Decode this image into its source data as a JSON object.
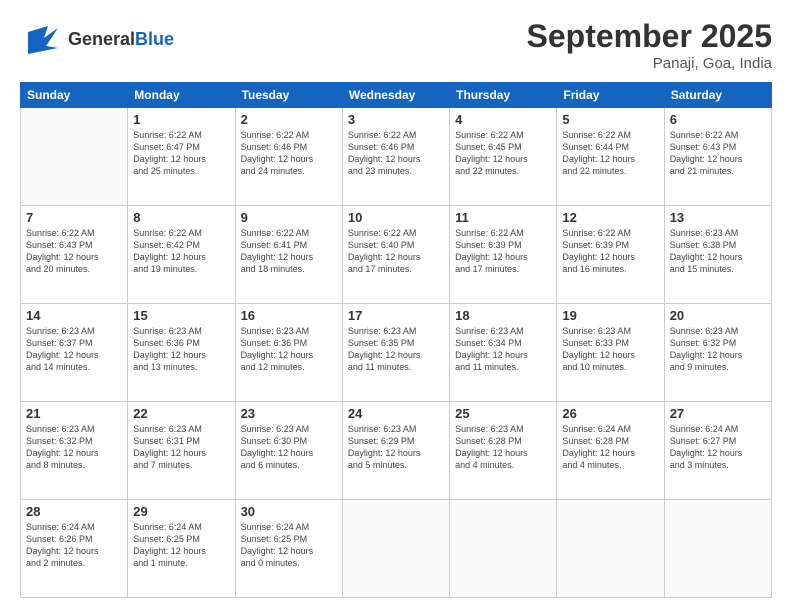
{
  "logo": {
    "general": "General",
    "blue": "Blue"
  },
  "header": {
    "month": "September 2025",
    "location": "Panaji, Goa, India"
  },
  "days_of_week": [
    "Sunday",
    "Monday",
    "Tuesday",
    "Wednesday",
    "Thursday",
    "Friday",
    "Saturday"
  ],
  "weeks": [
    [
      {
        "day": "",
        "info": ""
      },
      {
        "day": "1",
        "info": "Sunrise: 6:22 AM\nSunset: 6:47 PM\nDaylight: 12 hours\nand 25 minutes."
      },
      {
        "day": "2",
        "info": "Sunrise: 6:22 AM\nSunset: 6:46 PM\nDaylight: 12 hours\nand 24 minutes."
      },
      {
        "day": "3",
        "info": "Sunrise: 6:22 AM\nSunset: 6:46 PM\nDaylight: 12 hours\nand 23 minutes."
      },
      {
        "day": "4",
        "info": "Sunrise: 6:22 AM\nSunset: 6:45 PM\nDaylight: 12 hours\nand 22 minutes."
      },
      {
        "day": "5",
        "info": "Sunrise: 6:22 AM\nSunset: 6:44 PM\nDaylight: 12 hours\nand 22 minutes."
      },
      {
        "day": "6",
        "info": "Sunrise: 6:22 AM\nSunset: 6:43 PM\nDaylight: 12 hours\nand 21 minutes."
      }
    ],
    [
      {
        "day": "7",
        "info": "Sunrise: 6:22 AM\nSunset: 6:43 PM\nDaylight: 12 hours\nand 20 minutes."
      },
      {
        "day": "8",
        "info": "Sunrise: 6:22 AM\nSunset: 6:42 PM\nDaylight: 12 hours\nand 19 minutes."
      },
      {
        "day": "9",
        "info": "Sunrise: 6:22 AM\nSunset: 6:41 PM\nDaylight: 12 hours\nand 18 minutes."
      },
      {
        "day": "10",
        "info": "Sunrise: 6:22 AM\nSunset: 6:40 PM\nDaylight: 12 hours\nand 17 minutes."
      },
      {
        "day": "11",
        "info": "Sunrise: 6:22 AM\nSunset: 6:39 PM\nDaylight: 12 hours\nand 17 minutes."
      },
      {
        "day": "12",
        "info": "Sunrise: 6:22 AM\nSunset: 6:39 PM\nDaylight: 12 hours\nand 16 minutes."
      },
      {
        "day": "13",
        "info": "Sunrise: 6:23 AM\nSunset: 6:38 PM\nDaylight: 12 hours\nand 15 minutes."
      }
    ],
    [
      {
        "day": "14",
        "info": "Sunrise: 6:23 AM\nSunset: 6:37 PM\nDaylight: 12 hours\nand 14 minutes."
      },
      {
        "day": "15",
        "info": "Sunrise: 6:23 AM\nSunset: 6:36 PM\nDaylight: 12 hours\nand 13 minutes."
      },
      {
        "day": "16",
        "info": "Sunrise: 6:23 AM\nSunset: 6:36 PM\nDaylight: 12 hours\nand 12 minutes."
      },
      {
        "day": "17",
        "info": "Sunrise: 6:23 AM\nSunset: 6:35 PM\nDaylight: 12 hours\nand 11 minutes."
      },
      {
        "day": "18",
        "info": "Sunrise: 6:23 AM\nSunset: 6:34 PM\nDaylight: 12 hours\nand 11 minutes."
      },
      {
        "day": "19",
        "info": "Sunrise: 6:23 AM\nSunset: 6:33 PM\nDaylight: 12 hours\nand 10 minutes."
      },
      {
        "day": "20",
        "info": "Sunrise: 6:23 AM\nSunset: 6:32 PM\nDaylight: 12 hours\nand 9 minutes."
      }
    ],
    [
      {
        "day": "21",
        "info": "Sunrise: 6:23 AM\nSunset: 6:32 PM\nDaylight: 12 hours\nand 8 minutes."
      },
      {
        "day": "22",
        "info": "Sunrise: 6:23 AM\nSunset: 6:31 PM\nDaylight: 12 hours\nand 7 minutes."
      },
      {
        "day": "23",
        "info": "Sunrise: 6:23 AM\nSunset: 6:30 PM\nDaylight: 12 hours\nand 6 minutes."
      },
      {
        "day": "24",
        "info": "Sunrise: 6:23 AM\nSunset: 6:29 PM\nDaylight: 12 hours\nand 5 minutes."
      },
      {
        "day": "25",
        "info": "Sunrise: 6:23 AM\nSunset: 6:28 PM\nDaylight: 12 hours\nand 4 minutes."
      },
      {
        "day": "26",
        "info": "Sunrise: 6:24 AM\nSunset: 6:28 PM\nDaylight: 12 hours\nand 4 minutes."
      },
      {
        "day": "27",
        "info": "Sunrise: 6:24 AM\nSunset: 6:27 PM\nDaylight: 12 hours\nand 3 minutes."
      }
    ],
    [
      {
        "day": "28",
        "info": "Sunrise: 6:24 AM\nSunset: 6:26 PM\nDaylight: 12 hours\nand 2 minutes."
      },
      {
        "day": "29",
        "info": "Sunrise: 6:24 AM\nSunset: 6:25 PM\nDaylight: 12 hours\nand 1 minute."
      },
      {
        "day": "30",
        "info": "Sunrise: 6:24 AM\nSunset: 6:25 PM\nDaylight: 12 hours\nand 0 minutes."
      },
      {
        "day": "",
        "info": ""
      },
      {
        "day": "",
        "info": ""
      },
      {
        "day": "",
        "info": ""
      },
      {
        "day": "",
        "info": ""
      }
    ]
  ]
}
